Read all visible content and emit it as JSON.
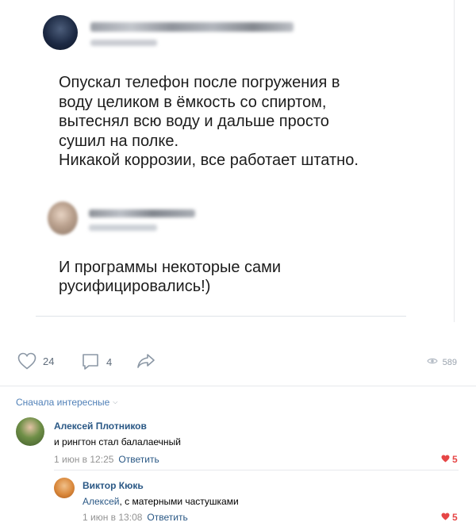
{
  "post": {
    "author_blurred": true,
    "text": "Опускал телефон после погружения в\nводу целиком в ёмкость со спиртом,\nвытеснял всю воду и дальше просто\nсушил на полке.\nНикакой коррозии, все работает штатно.",
    "reply": {
      "author_blurred": true,
      "text": "И программы некоторые сами\nрусифицировались!)"
    }
  },
  "actions": {
    "likes": "24",
    "comments": "4",
    "views": "589"
  },
  "sort_label": "Сначала интересные",
  "comments": [
    {
      "name": "Алексей Плотников",
      "text": "и рингтон стал балалаечный",
      "date": "1 июн в 12:25",
      "reply_label": "Ответить",
      "likes": "5"
    },
    {
      "name": "Виктор Кюкь",
      "mention": "Алексей",
      "text": ", с матерными частушками",
      "date": "1 июн в 13:08",
      "reply_label": "Ответить",
      "likes": "5"
    }
  ],
  "colors": {
    "link": "#2a5885",
    "like_red": "#e64646",
    "muted": "#939393"
  }
}
